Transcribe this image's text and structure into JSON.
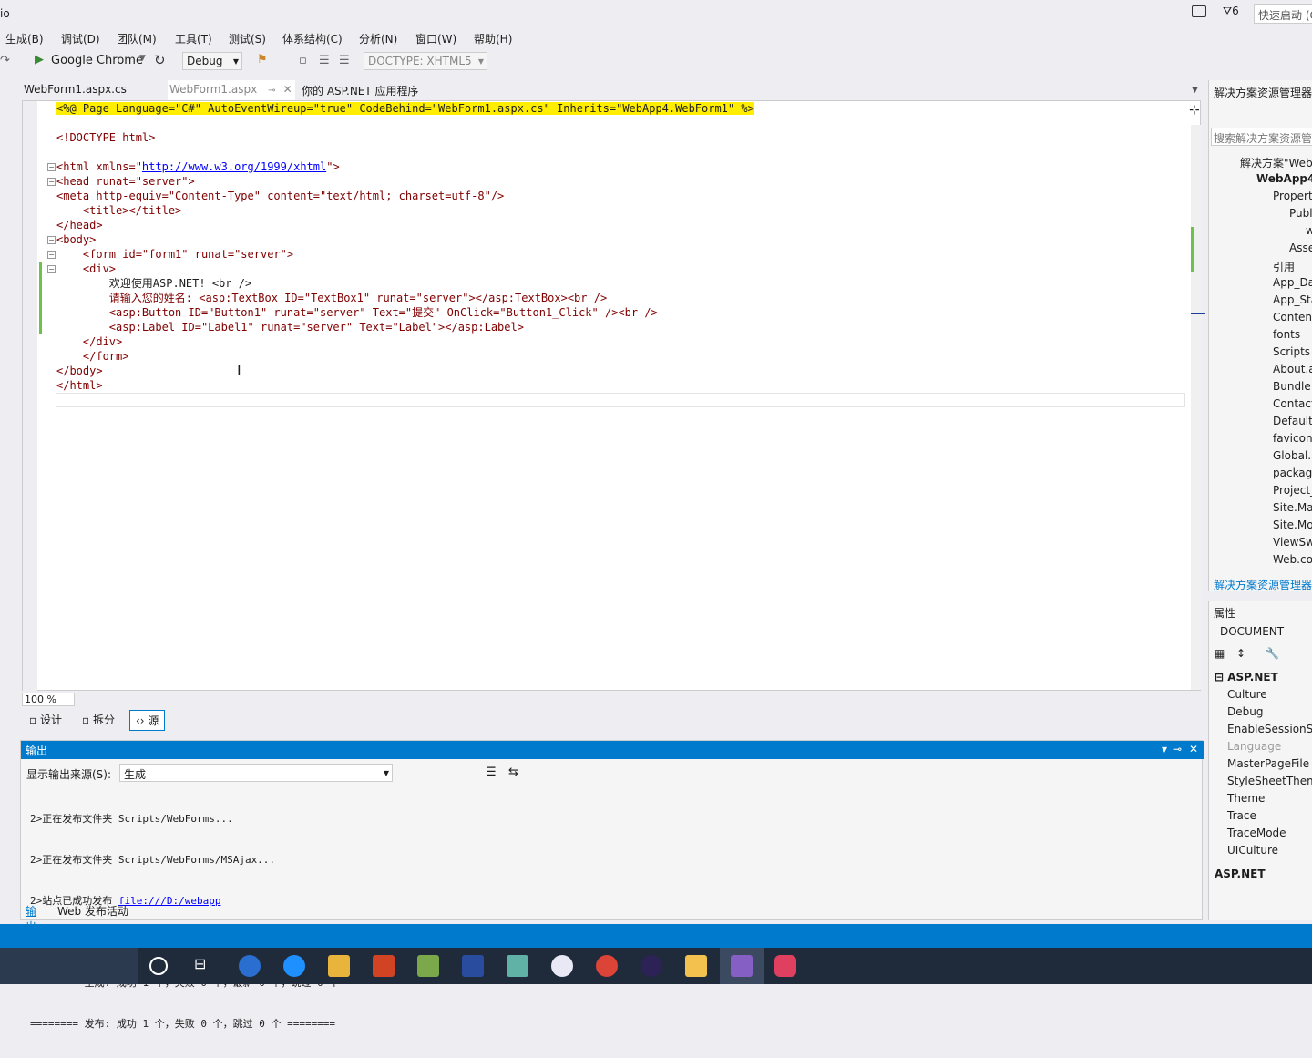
{
  "window": {
    "title_fragment": "io",
    "notifications_count": "6",
    "quick_launch": "快速启动 (C"
  },
  "menu": [
    "生成(B)",
    "调试(D)",
    "团队(M)",
    "工具(T)",
    "测试(S)",
    "体系结构(C)",
    "分析(N)",
    "窗口(W)",
    "帮助(H)"
  ],
  "toolbar": {
    "browser": "Google Chrome",
    "config": "Debug",
    "doctype": "DOCTYPE: XHTML5"
  },
  "tabs": [
    {
      "label": "WebForm1.aspx.cs"
    },
    {
      "label": "WebForm1.aspx"
    },
    {
      "label": "你的 ASP.NET 应用程序"
    }
  ],
  "code": {
    "l1": "<%@ Page Language=\"C#\" AutoEventWireup=\"true\" CodeBehind=\"WebForm1.aspx.cs\" Inherits=\"WebApp4.WebForm1\" %>",
    "l3": "<!DOCTYPE html>",
    "l5a": "<html xmlns=\"",
    "l5b": "http://www.w3.org/1999/xhtml",
    "l5c": "\">",
    "l6": "<head runat=\"server\">",
    "l7": "<meta http-equiv=\"Content-Type\" content=\"text/html; charset=utf-8\"/>",
    "l8": "    <title></title>",
    "l9": "</head>",
    "l10": "<body>",
    "l11": "    <form id=\"form1\" runat=\"server\">",
    "l12": "    <div>",
    "l13": "        欢迎使用ASP.NET! <br />",
    "l14": "        请输入您的姓名: <asp:TextBox ID=\"TextBox1\" runat=\"server\"></asp:TextBox><br />",
    "l15": "        <asp:Button ID=\"Button1\" runat=\"server\" Text=\"提交\" OnClick=\"Button1_Click\" /><br />",
    "l16": "        <asp:Label ID=\"Label1\" runat=\"server\" Text=\"Label\"></asp:Label>",
    "l17": "    </div>",
    "l18": "    </form>",
    "l19": "</body>",
    "l20": "</html>"
  },
  "editor": {
    "zoom": "100 %",
    "view_design": "设计",
    "view_split": "拆分",
    "view_source": "源"
  },
  "output": {
    "title": "输出",
    "source_label": "显示输出来源(S):",
    "source_value": "生成",
    "lines": [
      "2>正在发布文件夹 Scripts/WebForms...",
      "2>正在发布文件夹 Scripts/WebForms/MSAjax...",
      "2>站点已成功发布 ",
      "2>",
      "======== 生成: 成功 1 个，失败 0 个，最新 0 个，跳过 0 个 ========",
      "======== 发布: 成功 1 个，失败 0 个，跳过 0 个 ========"
    ],
    "publish_link": "file:///D:/webapp",
    "tab_output": "输出",
    "tab_web": "Web 发布活动"
  },
  "solution_explorer": {
    "title": "解决方案资源管理器",
    "search_placeholder": "搜索解决方案资源管",
    "items": [
      "解决方案\"Web",
      "WebApp4",
      "Propert",
      "Publ",
      "w",
      "Asse",
      "引用",
      "App_Da",
      "App_Sta",
      "Content",
      "fonts",
      "Scripts",
      "About.a",
      "Bundle.",
      "Contact",
      "Default.",
      "favicon.",
      "Global.a",
      "packag",
      "Project_",
      "Site.Ma",
      "Site.Mo",
      "ViewSw",
      "Web.co"
    ],
    "footer_tab": "解决方案资源管理器"
  },
  "properties": {
    "title": "属性",
    "object": "DOCUMENT",
    "category": "ASP.NET",
    "items": [
      "Culture",
      "Debug",
      "EnableSessionSt",
      "Language",
      "MasterPageFile",
      "StyleSheetTheme",
      "Theme",
      "Trace",
      "TraceMode",
      "UICulture"
    ],
    "description": "ASP.NET"
  }
}
